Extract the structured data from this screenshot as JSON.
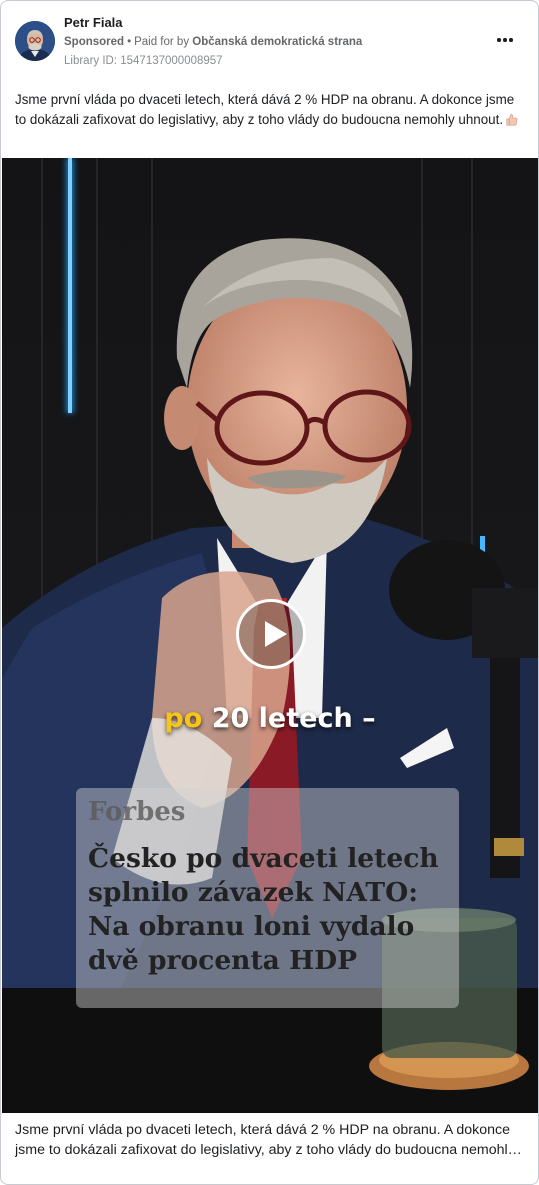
{
  "ad": {
    "page_name": "Petr Fiala",
    "sponsored_label": "Sponsored",
    "dot": "•",
    "paid_for_prefix": "Paid for by",
    "payer": "Občanská demokratická strana",
    "library_id": "Library ID: 1547137000008957",
    "more_icon": "more-horizontal-icon",
    "body_text": "Jsme první vláda po dvaceti letech, která dává 2 % HDP na obranu. A dokonce jsme to dokázali zafixovat do legislativy, aby z toho vlády do budoucna nemohly uhnout.",
    "body_emoji": "thumbs-up-emoji"
  },
  "video": {
    "play_icon": "play-icon",
    "caption_highlight": "po",
    "caption_rest": " 20 letech –",
    "overlay_brand": "Forbes",
    "overlay_headline": "Česko po dvaceti letech\nsplnilo závazek NATO:\nNa obranu loni vydalo\ndvě procenta HDP",
    "colors": {
      "caption_highlight": "#f5c518",
      "neon_accent": "#1fa6ff"
    }
  },
  "footer": {
    "text": "Jsme první vláda po dvaceti letech, která dává 2 % HDP na obranu. A dokonce jsme to dokázali zafixovat do legislativy, aby z toho vlády do budoucna nemohly uhnout."
  }
}
